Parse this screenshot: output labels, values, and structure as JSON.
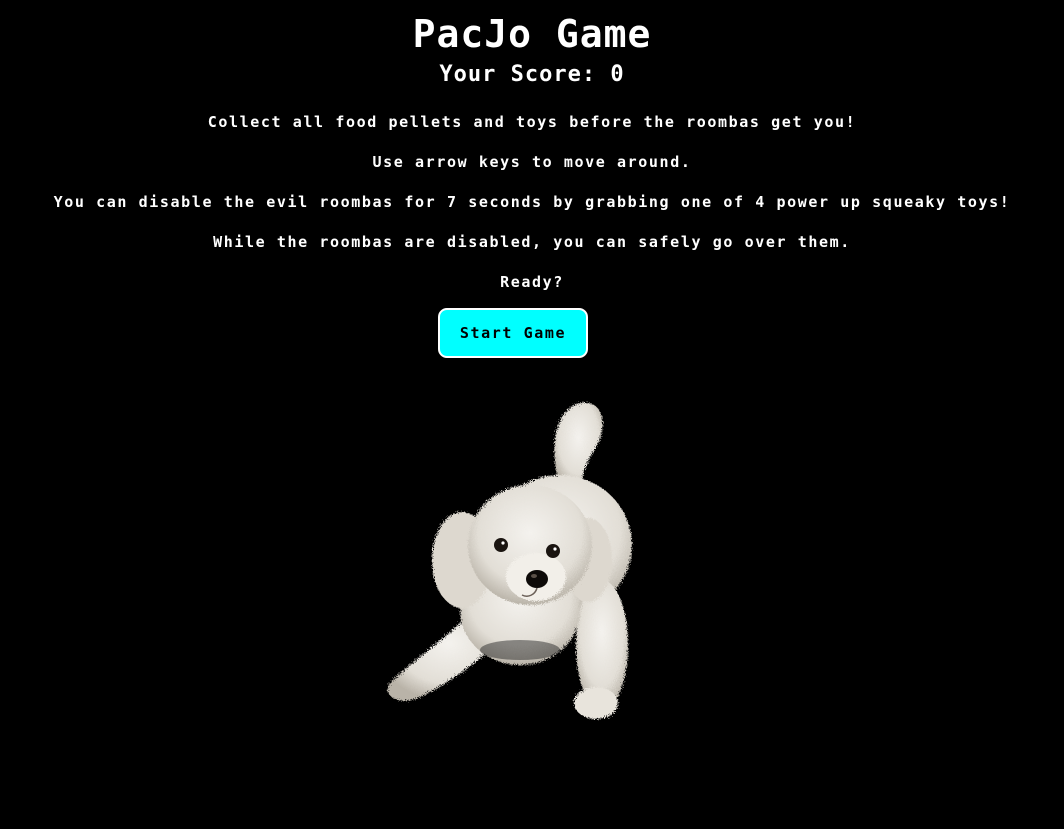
{
  "game": {
    "title": "PacJo Game",
    "score_line": "Your Score: 0",
    "instructions": [
      "Collect all food pellets and toys before the roombas get you!",
      "Use arrow keys to move around.",
      "You can disable the evil roombas for 7 seconds by grabbing one of 4 power up squeaky toys!",
      "While the roombas are disabled, you can safely go over them.",
      "Ready?"
    ],
    "start_button": "Start Game"
  },
  "colors": {
    "background": "#000000",
    "text": "#ffffff",
    "button": "#00ffff"
  },
  "icons": {
    "mascot": "white-poodle-dog"
  }
}
